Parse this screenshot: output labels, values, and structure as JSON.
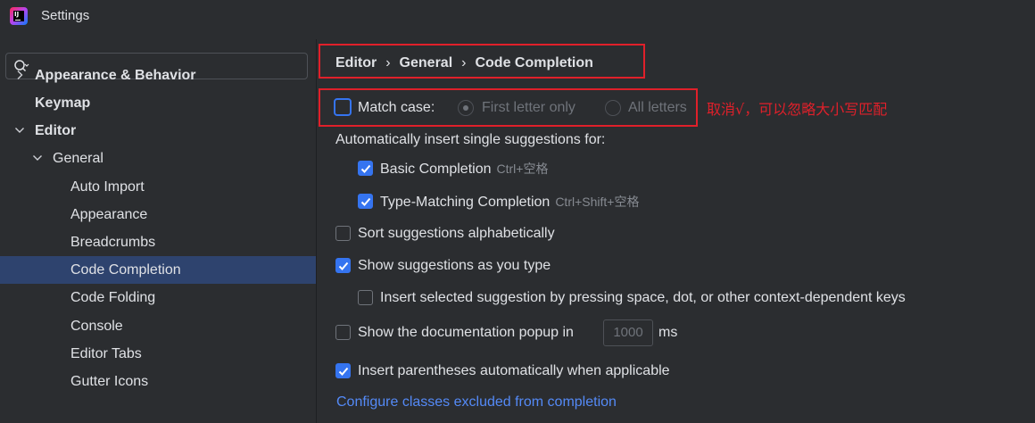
{
  "window": {
    "title": "Settings"
  },
  "search": {
    "placeholder": "",
    "value": ""
  },
  "tree": [
    {
      "label": "Appearance & Behavior",
      "bold": true,
      "arrow": "right",
      "indent": 0
    },
    {
      "label": "Keymap",
      "bold": true,
      "arrow": "",
      "indent": 0
    },
    {
      "label": "Editor",
      "bold": true,
      "arrow": "down",
      "indent": 0
    },
    {
      "label": "General",
      "bold": false,
      "arrow": "down",
      "indent": 1
    },
    {
      "label": "Auto Import",
      "bold": false,
      "arrow": "",
      "indent": 2
    },
    {
      "label": "Appearance",
      "bold": false,
      "arrow": "",
      "indent": 2
    },
    {
      "label": "Breadcrumbs",
      "bold": false,
      "arrow": "",
      "indent": 2
    },
    {
      "label": "Code Completion",
      "bold": false,
      "arrow": "",
      "indent": 2,
      "selected": true
    },
    {
      "label": "Code Folding",
      "bold": false,
      "arrow": "",
      "indent": 2
    },
    {
      "label": "Console",
      "bold": false,
      "arrow": "",
      "indent": 2
    },
    {
      "label": "Editor Tabs",
      "bold": false,
      "arrow": "",
      "indent": 2
    },
    {
      "label": "Gutter Icons",
      "bold": false,
      "arrow": "",
      "indent": 2
    }
  ],
  "breadcrumb": {
    "items": [
      "Editor",
      "General",
      "Code Completion"
    ],
    "separator": "›"
  },
  "match_case": {
    "label": "Match case:",
    "checked": false,
    "options": [
      {
        "label": "First letter only",
        "selected": true
      },
      {
        "label": "All letters",
        "selected": false
      }
    ]
  },
  "annotation": "取消√，可以忽略大小写匹配",
  "auto_insert": {
    "heading": "Automatically insert single suggestions for:",
    "basic": {
      "label": "Basic Completion",
      "shortcut": "Ctrl+空格",
      "checked": true
    },
    "type_matching": {
      "label": "Type-Matching Completion",
      "shortcut": "Ctrl+Shift+空格",
      "checked": true
    }
  },
  "sort_alpha": {
    "label": "Sort suggestions alphabetically",
    "checked": false
  },
  "show_as_type": {
    "label": "Show suggestions as you type",
    "checked": true
  },
  "insert_by_space": {
    "label": "Insert selected suggestion by pressing space, dot, or other context-dependent keys",
    "checked": false
  },
  "doc_popup": {
    "label": "Show the documentation popup in",
    "value": "1000",
    "unit": "ms",
    "checked": false
  },
  "insert_parens": {
    "label": "Insert parentheses automatically when applicable",
    "checked": true
  },
  "configure_link": "Configure classes excluded from completion",
  "colors": {
    "accent": "#3574f0",
    "selection": "#2e436e",
    "annotation": "#e0202a",
    "link": "#548af7"
  }
}
